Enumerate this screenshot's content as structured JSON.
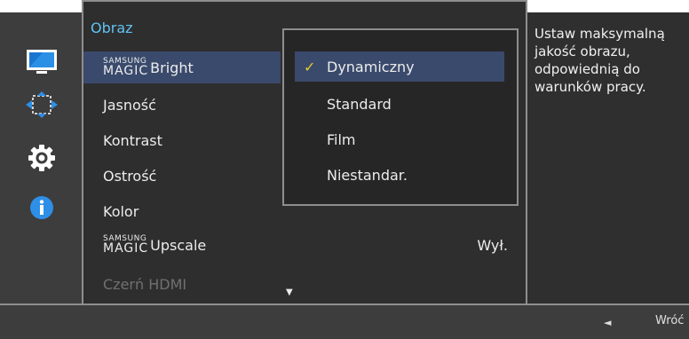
{
  "panel": {
    "title": "Obraz"
  },
  "menu": {
    "items": [
      {
        "label": "Bright",
        "prefix": {
          "top": "SAMSUNG",
          "bottom": "MAGIC"
        },
        "value": ""
      },
      {
        "label": "Jasność",
        "value": ""
      },
      {
        "label": "Kontrast",
        "value": ""
      },
      {
        "label": "Ostrość",
        "value": ""
      },
      {
        "label": "Kolor",
        "value": ""
      },
      {
        "label": "Upscale",
        "prefix": {
          "top": "SAMSUNG",
          "bottom": "MAGIC"
        },
        "value": "Wył."
      },
      {
        "label": "Czerń HDMI",
        "value": ""
      }
    ],
    "more_icon": "▼"
  },
  "dropdown": {
    "options": [
      "Dynamiczny",
      "Standard",
      "Film",
      "Niestandar."
    ],
    "selected": "Dynamiczny",
    "check_icon": "✓"
  },
  "help": {
    "text": "Ustaw maksymalną jakość obrazu, odpowiednią do warunków pracy."
  },
  "footer": {
    "back_label": "Wróć",
    "back_icon": "◄"
  },
  "icons": [
    "monitor-icon",
    "resize-icon",
    "settings-gear-icon",
    "info-icon"
  ],
  "colors": {
    "title": "#60c3f2",
    "selection": "#3a4a6c",
    "check": "#e6c833",
    "border": "#8e8e8e"
  }
}
